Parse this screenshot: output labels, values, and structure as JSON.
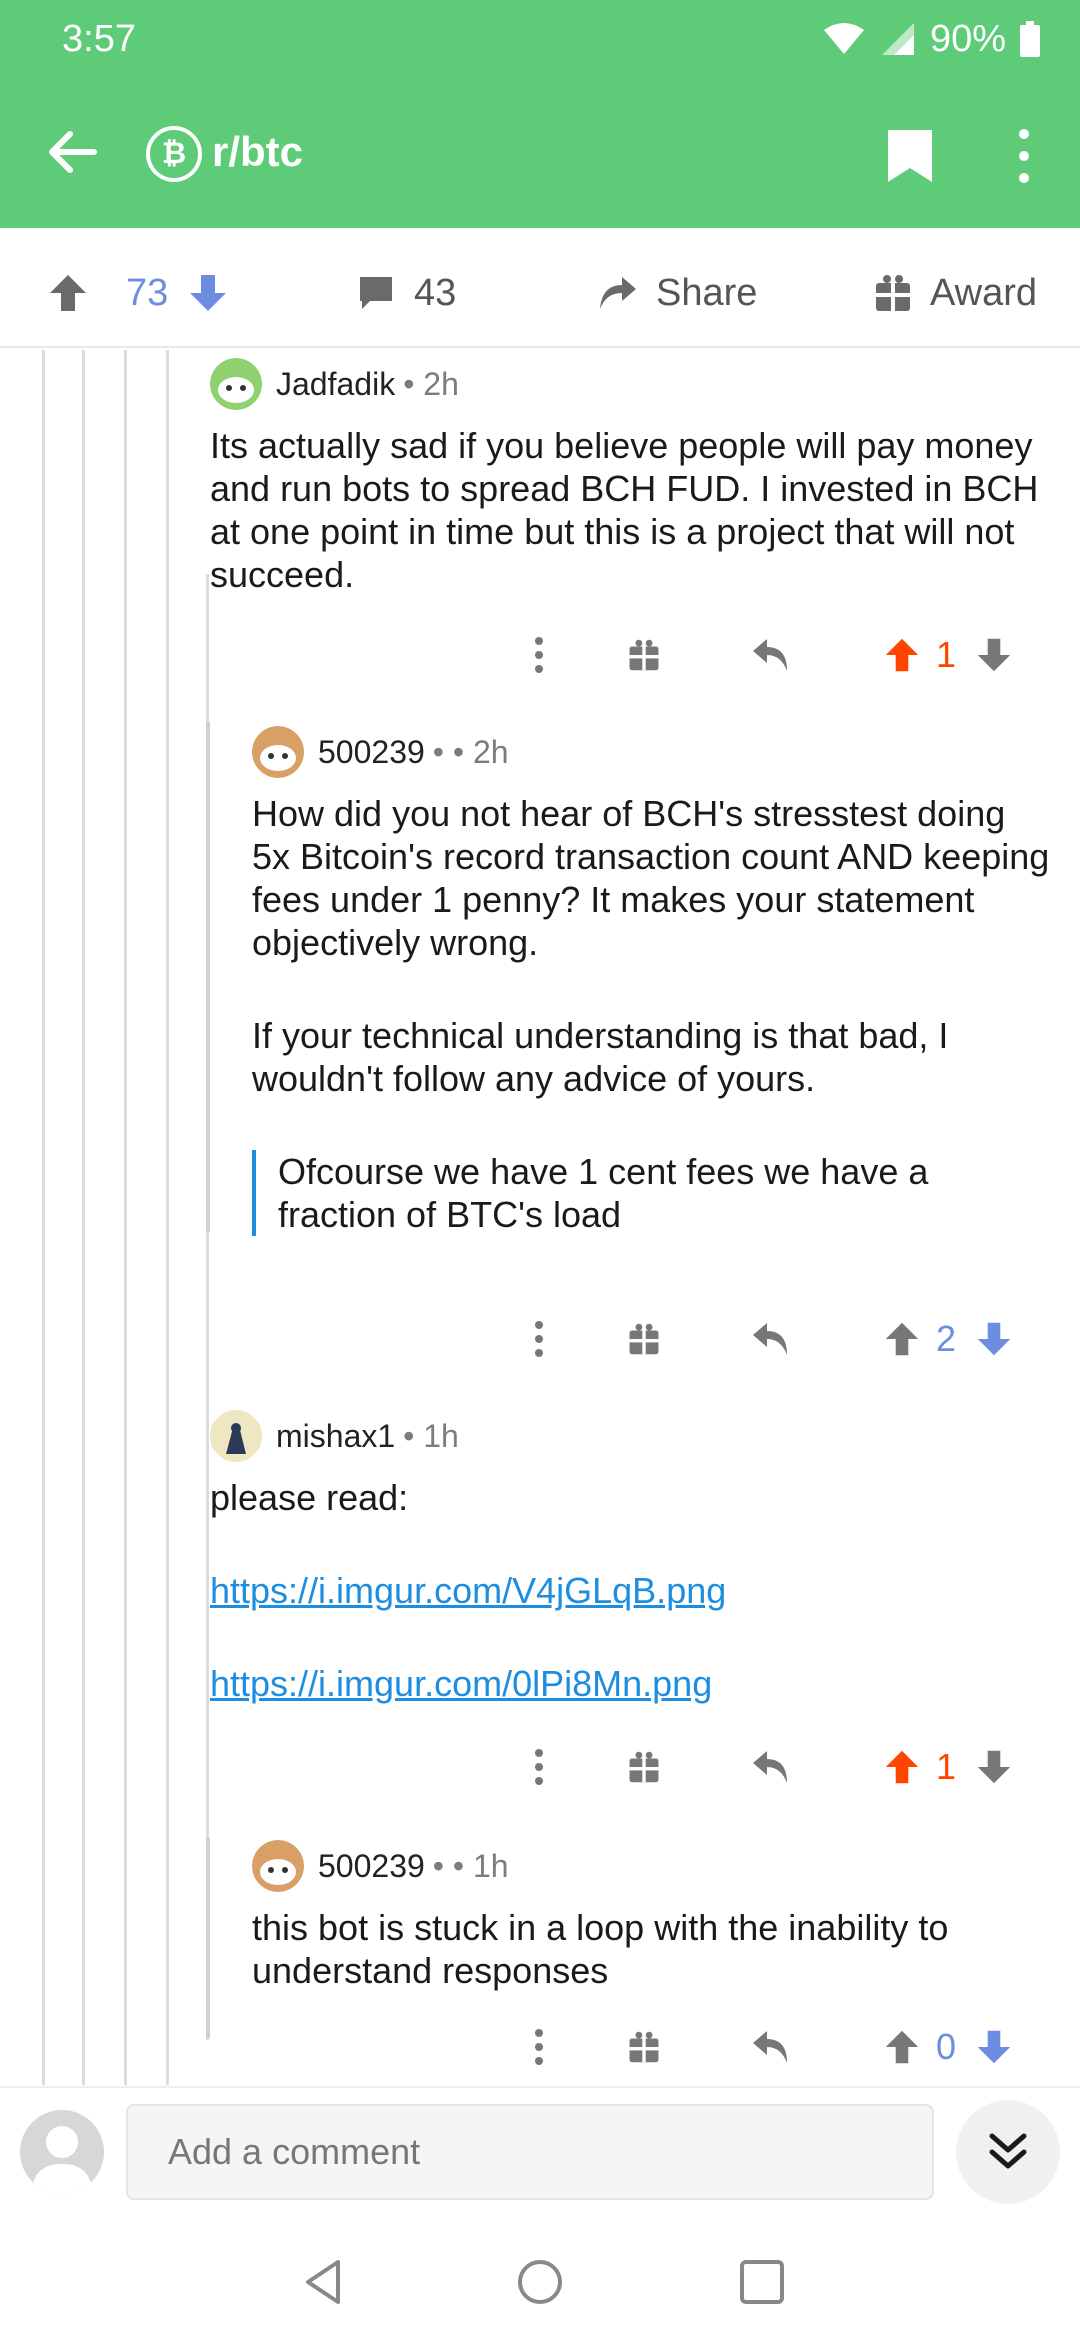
{
  "status": {
    "time": "3:57",
    "battery": "90%"
  },
  "toolbar": {
    "subreddit": "r/btc",
    "sub_icon_glyph": "₿"
  },
  "post_actions": {
    "votes": "73",
    "comments": "43",
    "share_label": "Share",
    "award_label": "Award"
  },
  "comments": [
    {
      "author": "Jadfadik",
      "age": "2h",
      "body": "Its actually sad if you believe people will pay money and run bots to spread BCH FUD. I invested in BCH at one point in time but this is a project that will not succeed.",
      "score": "1",
      "vote_state": "up"
    },
    {
      "author": "500239",
      "age": "• 2h",
      "paragraphs": [
        "How did you not hear of BCH's stresstest doing 5x Bitcoin's record transaction count AND keeping fees under 1 penny? It makes your statement objectively wrong.",
        "If your technical understanding is that bad, I wouldn't follow any advice of yours."
      ],
      "quote": "Ofcourse we have 1 cent fees we have a fraction of BTC's load",
      "score": "2",
      "vote_state": "none"
    },
    {
      "author": "mishax1",
      "age": "1h",
      "text": "please read:",
      "links": [
        "https://i.imgur.com/V4jGLqB.png",
        "https://i.imgur.com/0lPi8Mn.png"
      ],
      "score": "1",
      "vote_state": "up"
    },
    {
      "author": "500239",
      "age": "• 1h",
      "body": "this bot is stuck in a loop with the inability to understand responses",
      "score": "0",
      "vote_state": "none"
    }
  ],
  "composer": {
    "placeholder": "Add a comment"
  },
  "colors": {
    "header": "#5ecb78",
    "upvote": "#ff4500",
    "downvote_blue": "#6d8ee0",
    "link": "#1d8ddf"
  }
}
